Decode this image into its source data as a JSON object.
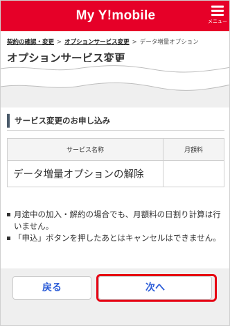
{
  "header": {
    "brand": "My Y!mobile",
    "menu_label": "メニュー",
    "bg_color": "#e60028"
  },
  "breadcrumb": {
    "items": [
      "契約の確認・変更",
      "オプションサービス変更"
    ],
    "current": "データ増量オプション",
    "separator": ">"
  },
  "page_title": "オプションサービス変更",
  "section": {
    "heading": "サービス変更のお申し込み"
  },
  "table": {
    "headers": [
      "サービス名称",
      "月額料"
    ],
    "rows": [
      {
        "name": "データ増量オプションの解除",
        "fee": ""
      }
    ]
  },
  "notes": [
    "月途中の加入・解約の場合でも、月額料の日割り計算は行いません。",
    "「申込」ボタンを押したあとはキャンセルはできません。"
  ],
  "buttons": {
    "back": "戻る",
    "next": "次へ",
    "highlight_color": "#e60012"
  }
}
